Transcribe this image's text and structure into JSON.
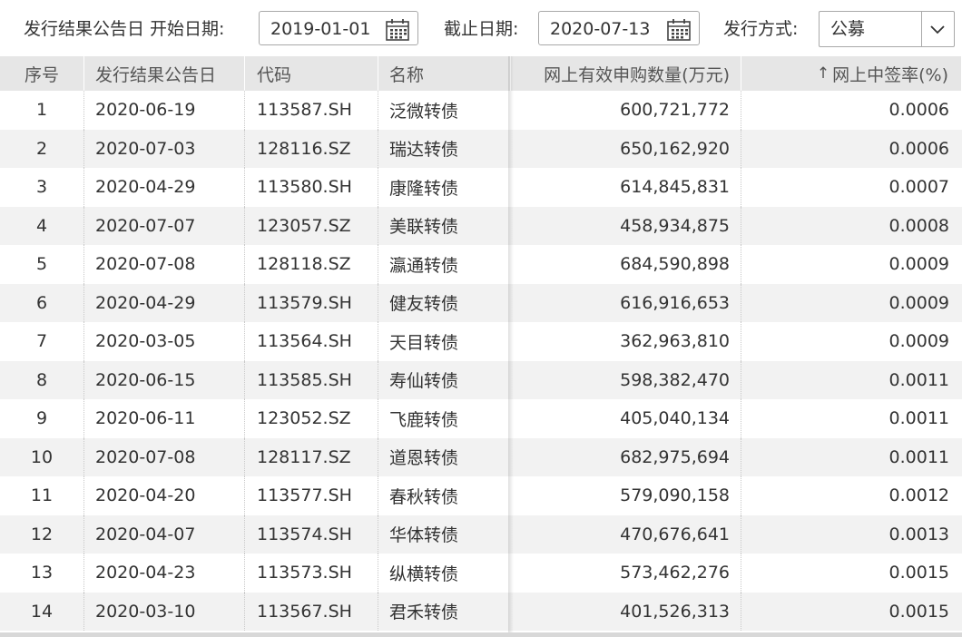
{
  "filters": {
    "start_label": "发行结果公告日 开始日期:",
    "start_value": "2019-01-01",
    "end_label": "截止日期:",
    "end_value": "2020-07-13",
    "method_label": "发行方式:",
    "method_value": "公募"
  },
  "table": {
    "headers": [
      "序号",
      "发行结果公告日",
      "代码",
      "名称",
      "网上有效申购数量(万元)",
      "网上中签率(%)"
    ],
    "sort_indicator": "↑",
    "rows": [
      [
        "1",
        "2020-06-19",
        "113587.SH",
        "泛微转债",
        "600,721,772",
        "0.0006"
      ],
      [
        "2",
        "2020-07-03",
        "128116.SZ",
        "瑞达转债",
        "650,162,920",
        "0.0006"
      ],
      [
        "3",
        "2020-04-29",
        "113580.SH",
        "康隆转债",
        "614,845,831",
        "0.0007"
      ],
      [
        "4",
        "2020-07-07",
        "123057.SZ",
        "美联转债",
        "458,934,875",
        "0.0008"
      ],
      [
        "5",
        "2020-07-08",
        "128118.SZ",
        "瀛通转债",
        "684,590,898",
        "0.0009"
      ],
      [
        "6",
        "2020-04-29",
        "113579.SH",
        "健友转债",
        "616,916,653",
        "0.0009"
      ],
      [
        "7",
        "2020-03-05",
        "113564.SH",
        "天目转债",
        "362,963,810",
        "0.0009"
      ],
      [
        "8",
        "2020-06-15",
        "113585.SH",
        "寿仙转债",
        "598,382,470",
        "0.0011"
      ],
      [
        "9",
        "2020-06-11",
        "123052.SZ",
        "飞鹿转债",
        "405,040,134",
        "0.0011"
      ],
      [
        "10",
        "2020-07-08",
        "128117.SZ",
        "道恩转债",
        "682,975,694",
        "0.0011"
      ],
      [
        "11",
        "2020-04-20",
        "113577.SH",
        "春秋转债",
        "579,090,158",
        "0.0012"
      ],
      [
        "12",
        "2020-04-07",
        "113574.SH",
        "华体转债",
        "470,676,641",
        "0.0013"
      ],
      [
        "13",
        "2020-04-23",
        "113573.SH",
        "纵横转债",
        "573,462,276",
        "0.0015"
      ],
      [
        "14",
        "2020-03-10",
        "113567.SH",
        "君禾转债",
        "401,526,313",
        "0.0015"
      ]
    ]
  }
}
